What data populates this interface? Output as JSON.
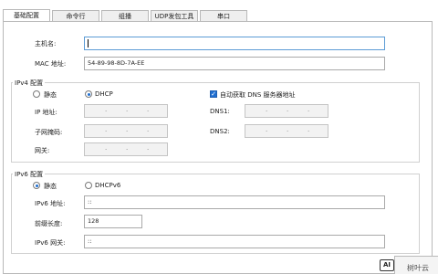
{
  "tabs": [
    {
      "label": "基础配置",
      "active": true
    },
    {
      "label": "命令行",
      "active": false
    },
    {
      "label": "组播",
      "active": false
    },
    {
      "label": "UDP发包工具",
      "active": false
    },
    {
      "label": "串口",
      "active": false
    }
  ],
  "basic": {
    "hostname_label": "主机名:",
    "hostname_value": "",
    "mac_label": "MAC 地址:",
    "mac_value": "54-89-98-8D-7A-EE"
  },
  "ipv4": {
    "group_label": "IPv4 配置",
    "static_label": "静态",
    "dhcp_label": "DHCP",
    "mode": "DHCP",
    "auto_dns_label": "自动获取 DNS 服务器地址",
    "auto_dns_checked": true,
    "ip_label": "IP 地址:",
    "mask_label": "子网掩码:",
    "gateway_label": "网关:",
    "dns1_label": "DNS1:",
    "dns2_label": "DNS2:"
  },
  "ipv6": {
    "group_label": "IPv6 配置",
    "static_label": "静态",
    "dhcpv6_label": "DHCPv6",
    "mode": "静态",
    "addr_label": "IPv6 地址:",
    "addr_value": "::",
    "prefix_label": "前缀长度:",
    "prefix_value": "128",
    "gateway_label": "IPv6 网关:",
    "gateway_value": "::"
  },
  "watermark": {
    "logo": "AI",
    "text": "树叶云"
  },
  "colors": {
    "accent": "#1f6fd1",
    "border": "#b9b9b9"
  }
}
